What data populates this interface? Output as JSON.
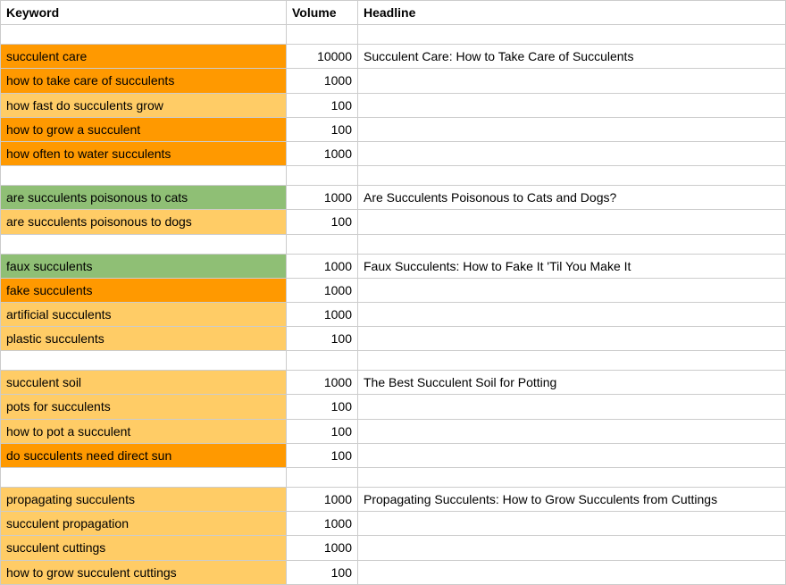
{
  "headers": {
    "keyword": "Keyword",
    "volume": "Volume",
    "headline": "Headline"
  },
  "colors": {
    "orange": "#ff9900",
    "yellow": "#ffcc66",
    "green": "#8fbf75"
  },
  "rows": [
    {
      "type": "blank"
    },
    {
      "type": "data",
      "keyword": "succulent care",
      "volume": 10000,
      "headline": "Succulent Care: How to Take Care of Succulents",
      "color": "orange"
    },
    {
      "type": "data",
      "keyword": "how to take care of succulents",
      "volume": 1000,
      "headline": "",
      "color": "orange"
    },
    {
      "type": "data",
      "keyword": "how fast do succulents grow",
      "volume": 100,
      "headline": "",
      "color": "yellow"
    },
    {
      "type": "data",
      "keyword": "how to grow a succulent",
      "volume": 100,
      "headline": "",
      "color": "orange"
    },
    {
      "type": "data",
      "keyword": "how often to water succulents",
      "volume": 1000,
      "headline": "",
      "color": "orange"
    },
    {
      "type": "blank"
    },
    {
      "type": "data",
      "keyword": "are succulents poisonous to cats",
      "volume": 1000,
      "headline": "Are Succulents Poisonous to Cats and Dogs?",
      "color": "green"
    },
    {
      "type": "data",
      "keyword": "are succulents poisonous to dogs",
      "volume": 100,
      "headline": "",
      "color": "yellow"
    },
    {
      "type": "blank"
    },
    {
      "type": "data",
      "keyword": "faux succulents",
      "volume": 1000,
      "headline": "Faux Succulents: How to Fake It 'Til You Make It",
      "color": "green"
    },
    {
      "type": "data",
      "keyword": "fake succulents",
      "volume": 1000,
      "headline": "",
      "color": "orange"
    },
    {
      "type": "data",
      "keyword": "artificial succulents",
      "volume": 1000,
      "headline": "",
      "color": "yellow"
    },
    {
      "type": "data",
      "keyword": "plastic succulents",
      "volume": 100,
      "headline": "",
      "color": "yellow"
    },
    {
      "type": "blank"
    },
    {
      "type": "data",
      "keyword": "succulent soil",
      "volume": 1000,
      "headline": "The Best Succulent Soil for Potting",
      "color": "yellow"
    },
    {
      "type": "data",
      "keyword": "pots for succulents",
      "volume": 100,
      "headline": "",
      "color": "yellow"
    },
    {
      "type": "data",
      "keyword": "how to pot a succulent",
      "volume": 100,
      "headline": "",
      "color": "yellow"
    },
    {
      "type": "data",
      "keyword": "do succulents need direct sun",
      "volume": 100,
      "headline": "",
      "color": "orange"
    },
    {
      "type": "blank"
    },
    {
      "type": "data",
      "keyword": "propagating succulents",
      "volume": 1000,
      "headline": "Propagating Succulents: How to Grow Succulents from Cuttings",
      "color": "yellow"
    },
    {
      "type": "data",
      "keyword": "succulent propagation",
      "volume": 1000,
      "headline": "",
      "color": "yellow"
    },
    {
      "type": "data",
      "keyword": "succulent cuttings",
      "volume": 1000,
      "headline": "",
      "color": "yellow"
    },
    {
      "type": "data",
      "keyword": "how to grow succulent cuttings",
      "volume": 100,
      "headline": "",
      "color": "yellow"
    }
  ]
}
